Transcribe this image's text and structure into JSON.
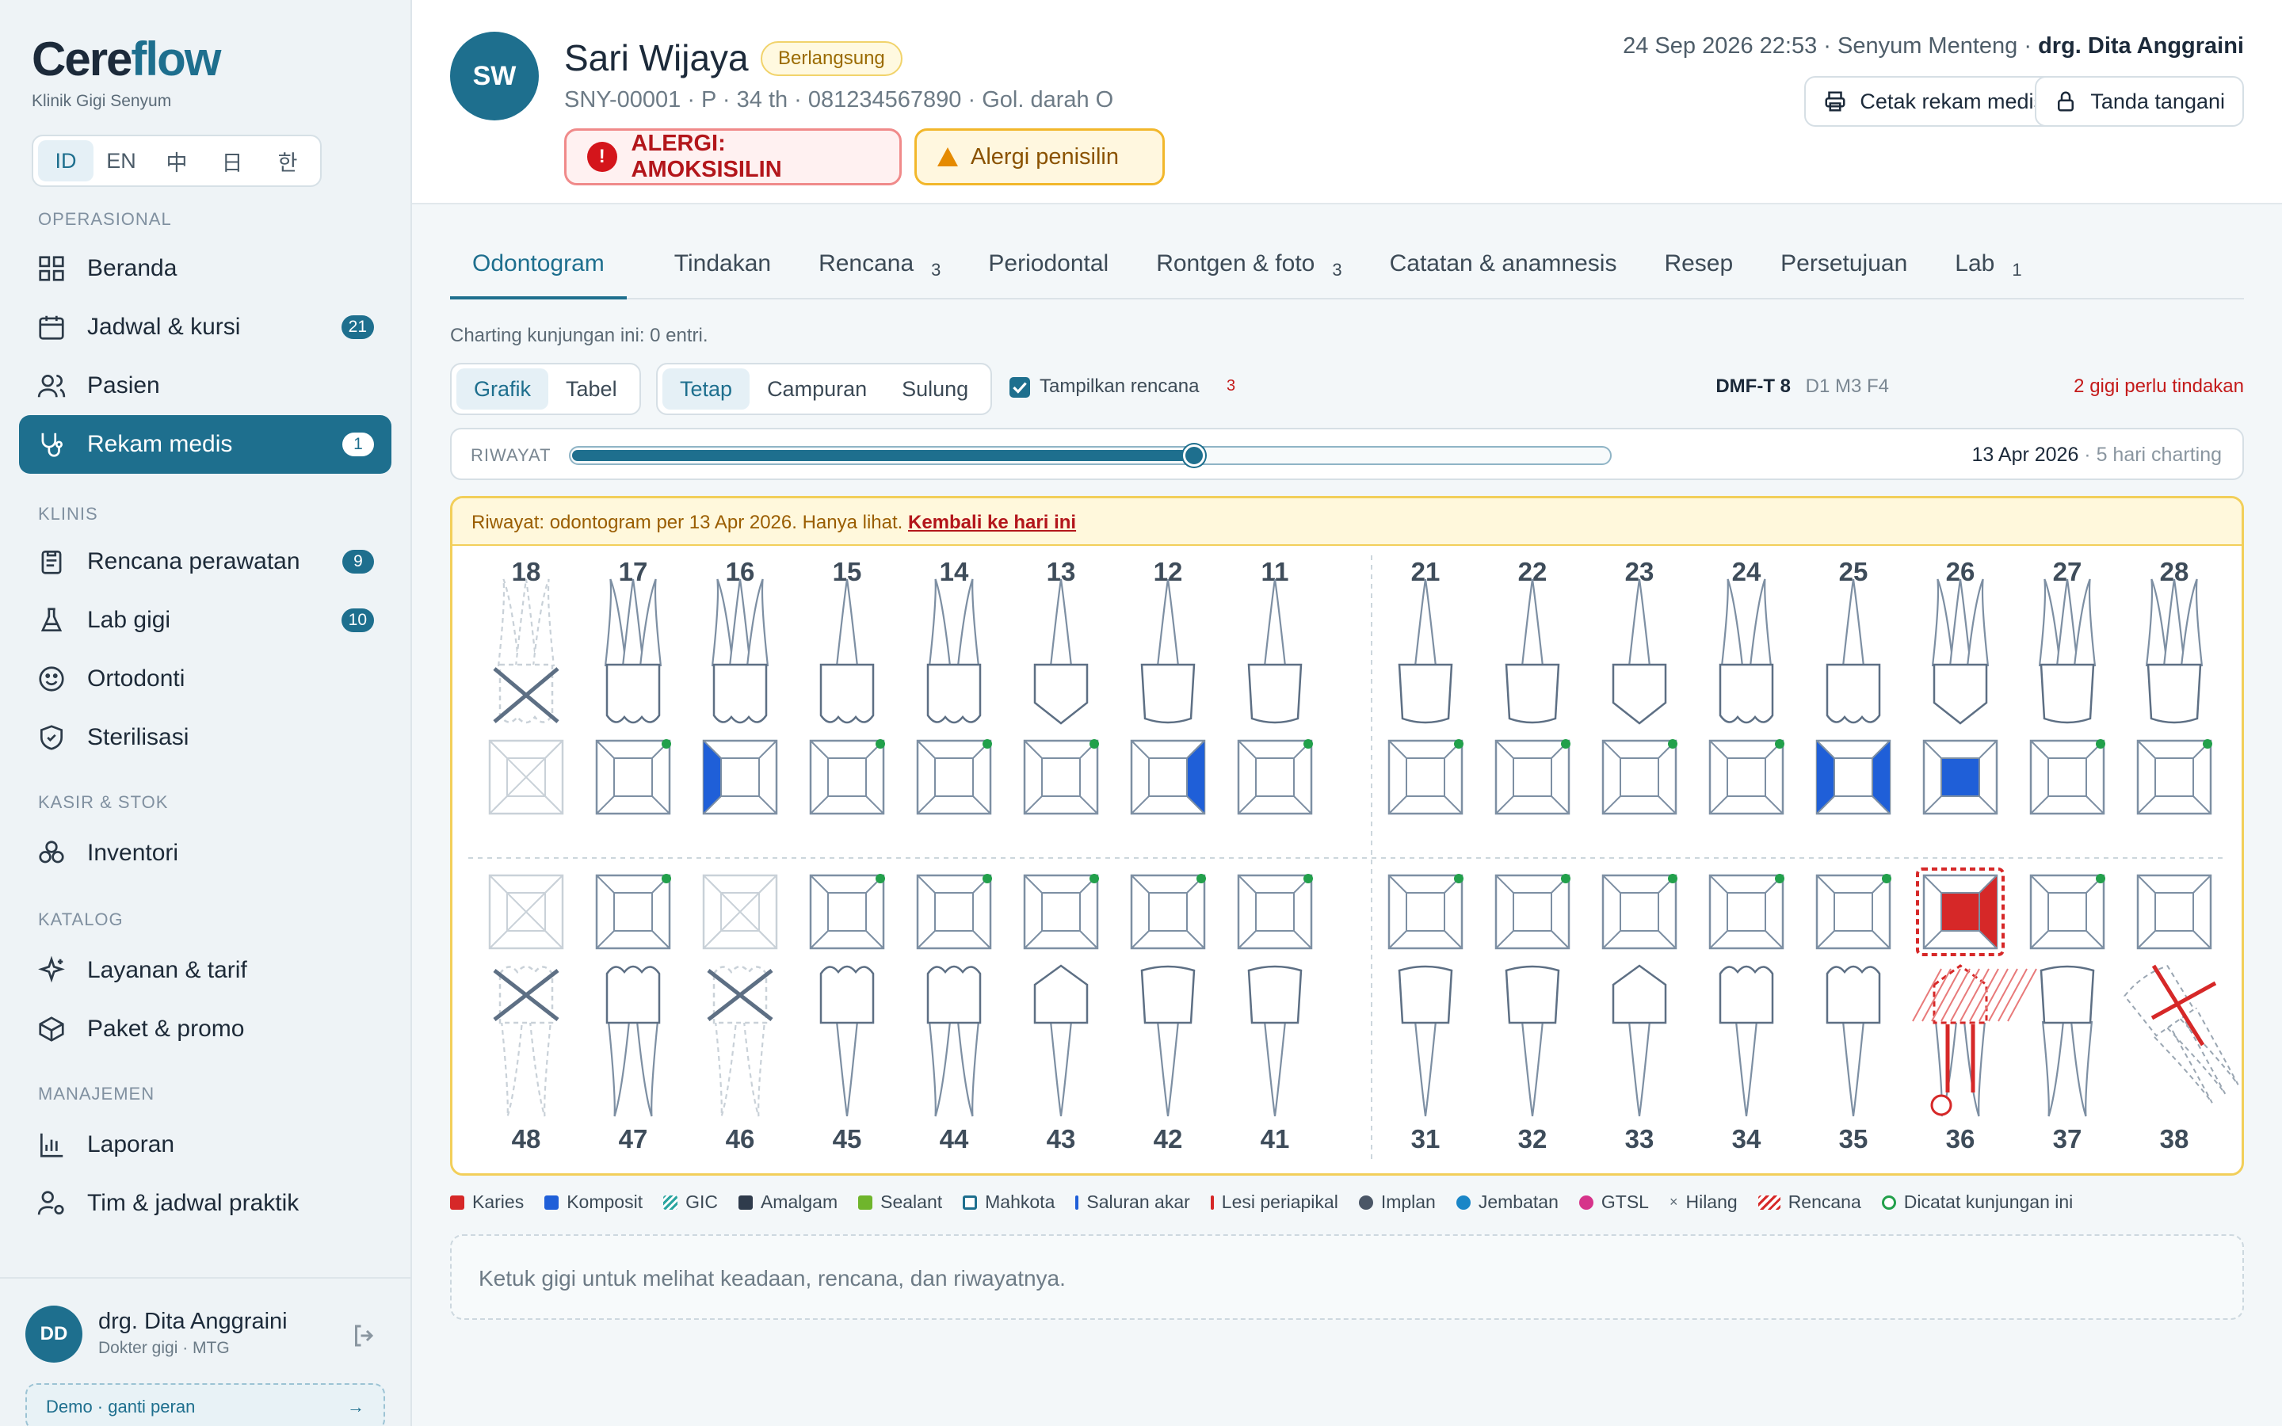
{
  "brand": {
    "name_a": "Cere",
    "name_b": "flow",
    "subtitle": "Klinik Gigi Senyum"
  },
  "languages": [
    {
      "code": "ID",
      "active": true
    },
    {
      "code": "EN"
    },
    {
      "code": "中"
    },
    {
      "code": "日"
    },
    {
      "code": "한"
    }
  ],
  "sidebar": {
    "sections": [
      "OPERASIONAL",
      "KLINIS",
      "KASIR & STOK",
      "KATALOG",
      "MANAJEMEN"
    ],
    "items": [
      {
        "label": "Beranda",
        "icon": "grid-icon"
      },
      {
        "label": "Jadwal & kursi",
        "icon": "calendar-icon",
        "badge": "21"
      },
      {
        "label": "Pasien",
        "icon": "users-icon"
      },
      {
        "label": "Rekam medis",
        "icon": "stethoscope-icon",
        "badge": "1",
        "active": true
      },
      {
        "label": "Rencana perawatan",
        "icon": "clipboard-icon",
        "badge": "9"
      },
      {
        "label": "Lab gigi",
        "icon": "flask-icon",
        "badge": "10"
      },
      {
        "label": "Ortodonti",
        "icon": "smile-icon"
      },
      {
        "label": "Sterilisasi",
        "icon": "shield-icon"
      },
      {
        "label": "Inventori",
        "icon": "boxes-icon"
      },
      {
        "label": "Layanan & tarif",
        "icon": "sparkle-icon"
      },
      {
        "label": "Paket & promo",
        "icon": "package-icon"
      },
      {
        "label": "Laporan",
        "icon": "bar-chart-icon"
      },
      {
        "label": "Tim & jadwal praktik",
        "icon": "user-cog-icon"
      }
    ]
  },
  "user": {
    "initials": "DD",
    "name": "drg. Dita Anggraini",
    "role": "Dokter gigi · MTG",
    "demo": "Demo · ganti peran",
    "demo_arrow": "→"
  },
  "patient": {
    "initials": "SW",
    "name": "Sari Wijaya",
    "status": "Berlangsung",
    "meta": "SNY-00001 · P · 34 th · 081234567890 · Gol. darah O",
    "allergy_main": "ALERGI: AMOKSISILIN",
    "allergy_main_icon": "!",
    "allergy_secondary": "Alergi penisilin"
  },
  "header": {
    "datetime": "24 Sep 2026 22:53 · Senyum Menteng · ",
    "doctor": "drg. Dita Anggraini",
    "print_label": "Cetak rekam medis",
    "sign_label": "Tanda tangani"
  },
  "tabs": [
    {
      "label": "Odontogram",
      "active": true
    },
    {
      "label": "Tindakan"
    },
    {
      "label": "Rencana",
      "count": "3"
    },
    {
      "label": "Periodontal"
    },
    {
      "label": "Rontgen & foto",
      "count": "3"
    },
    {
      "label": "Catatan & anamnesis"
    },
    {
      "label": "Resep"
    },
    {
      "label": "Persetujuan"
    },
    {
      "label": "Lab",
      "count": "1"
    }
  ],
  "charting_info": "Charting kunjungan ini: 0 entri.",
  "view_toggle": [
    "Grafik",
    "Tabel"
  ],
  "dentition_toggle": [
    "Tetap",
    "Campuran",
    "Sulung"
  ],
  "show_plan": {
    "label": "Tampilkan rencana",
    "count": "3",
    "checked": true
  },
  "dmft": {
    "label": "DMF-T 8",
    "detail": "D1 M3 F4",
    "action": "2 gigi perlu tindakan"
  },
  "history": {
    "label": "RIWAYAT",
    "date": "13 Apr 2026",
    "days": " · 5 hari charting",
    "position": 0.6
  },
  "banner": {
    "text": "Riwayat: odontogram per 13 Apr 2026. Hanya lihat. ",
    "link": "Kembali ke hari ini"
  },
  "upper_teeth": [
    "18",
    "17",
    "16",
    "15",
    "14",
    "13",
    "12",
    "11",
    "21",
    "22",
    "23",
    "24",
    "25",
    "26",
    "27",
    "28"
  ],
  "lower_teeth": [
    "48",
    "47",
    "46",
    "45",
    "44",
    "43",
    "42",
    "41",
    "31",
    "32",
    "33",
    "34",
    "35",
    "36",
    "37",
    "38"
  ],
  "tooth_states": {
    "missing": [
      "18",
      "48",
      "46"
    ],
    "composite_full": [
      "26"
    ],
    "composite_left": [
      "16",
      "25"
    ],
    "composite_right": [
      "12",
      "25"
    ],
    "caries": [
      "36"
    ],
    "plan": [
      "36",
      "38"
    ],
    "visit_dot": [
      "17",
      "15",
      "14",
      "13",
      "11",
      "21",
      "22",
      "23",
      "24",
      "27",
      "28",
      "47",
      "45",
      "44",
      "43",
      "42",
      "41",
      "31",
      "32",
      "33",
      "34",
      "35",
      "37"
    ]
  },
  "legend": [
    {
      "label": "Karies",
      "color": "#d62828"
    },
    {
      "label": "Komposit",
      "color": "#1f5fd8"
    },
    {
      "label": "GIC",
      "color": "#2aa5a0"
    },
    {
      "label": "Amalgam",
      "color": "#2f3b4c"
    },
    {
      "label": "Sealant",
      "color": "#6fb52c"
    },
    {
      "label": "Mahkota",
      "color": "#1e6f8e"
    },
    {
      "label": "Saluran akar",
      "color": "#1f5fd8"
    },
    {
      "label": "Lesi periapikal",
      "color": "#d62828"
    },
    {
      "label": "Implan",
      "color": "#4a5666"
    },
    {
      "label": "Jembatan",
      "color": "#1a86c7"
    },
    {
      "label": "GTSL",
      "color": "#d6338a"
    },
    {
      "label": "Hilang",
      "color": "#5c6a75"
    },
    {
      "label": "Rencana",
      "color": "#d62828"
    },
    {
      "label": "Dicatat kunjungan ini",
      "color": "#22a04b"
    }
  ],
  "detail_hint": "Ketuk gigi untuk melihat keadaan, rencana, dan riwayatnya."
}
